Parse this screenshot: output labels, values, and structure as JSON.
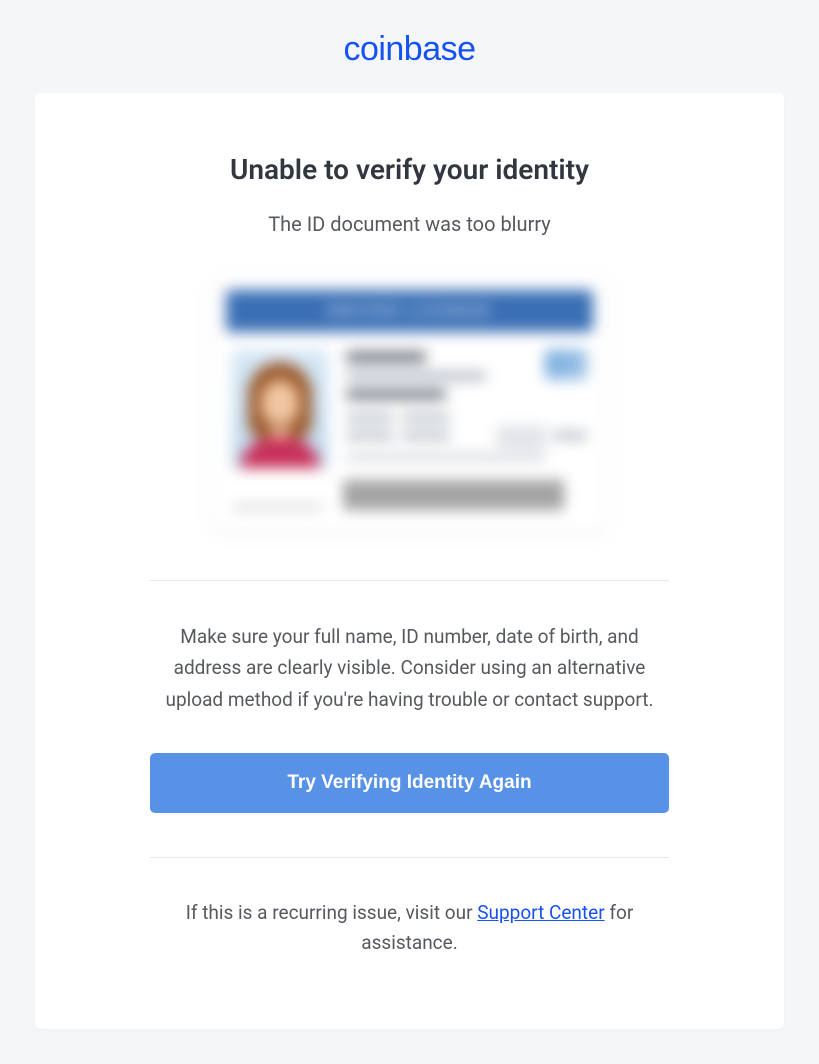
{
  "brand": {
    "name": "coinbase"
  },
  "main": {
    "title": "Unable to verify your identity",
    "subtitle": "The ID document was too blurry",
    "body_text": "Make sure your full name, ID number, date of birth, and address are clearly visible. Consider using an alternative upload method if you're having trouble or contact support.",
    "cta_label": "Try Verifying Identity Again"
  },
  "footer": {
    "prefix": "If this is a recurring issue, visit our ",
    "link_text": "Support Center",
    "suffix": " for assistance."
  }
}
